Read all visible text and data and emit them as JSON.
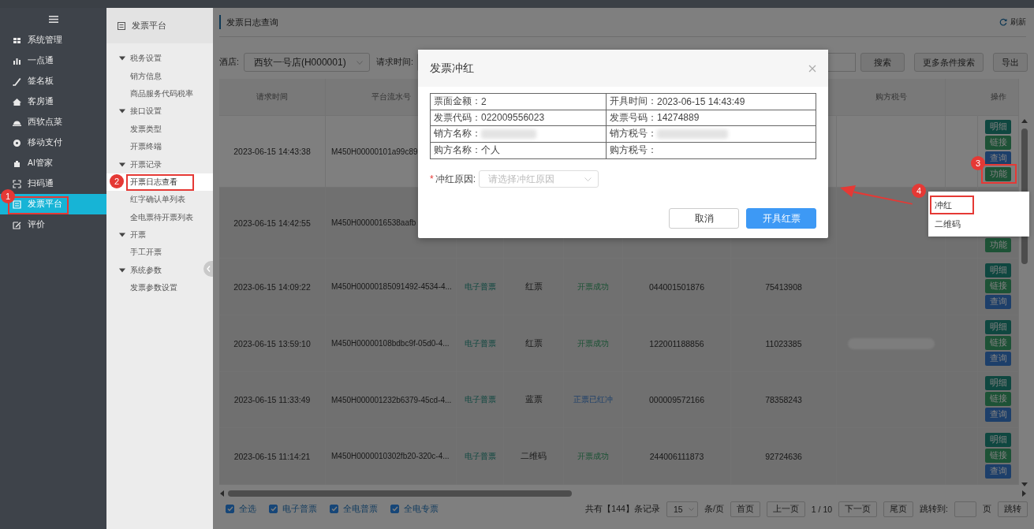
{
  "sidebar": {
    "items": [
      {
        "label": "系统管理",
        "selected": false
      },
      {
        "label": "一点通",
        "selected": false
      },
      {
        "label": "签名板",
        "selected": false
      },
      {
        "label": "客房通",
        "selected": false
      },
      {
        "label": "西软点菜",
        "selected": false
      },
      {
        "label": "移动支付",
        "selected": false
      },
      {
        "label": "AI管家",
        "selected": false
      },
      {
        "label": "扫码通",
        "selected": false
      },
      {
        "label": "发票平台",
        "selected": true,
        "annotation": "1"
      },
      {
        "label": "评价",
        "selected": false
      }
    ]
  },
  "subnav": {
    "title": "发票平台",
    "groups": [
      {
        "label": "税务设置",
        "expanded": true,
        "children": [
          {
            "label": "销方信息",
            "selected": false
          },
          {
            "label": "商品服务代码税率",
            "selected": false
          }
        ]
      },
      {
        "label": "接口设置",
        "expanded": true,
        "children": [
          {
            "label": "发票类型",
            "selected": false
          },
          {
            "label": "开票终端",
            "selected": false
          }
        ]
      },
      {
        "label": "开票记录",
        "expanded": true,
        "children": [
          {
            "label": "开票日志查看",
            "selected": true,
            "annotation": "2"
          },
          {
            "label": "红字确认单列表",
            "selected": false
          },
          {
            "label": "全电票待开票列表",
            "selected": false
          }
        ]
      },
      {
        "label": "开票",
        "expanded": true,
        "children": [
          {
            "label": "手工开票",
            "selected": false
          }
        ]
      },
      {
        "label": "系统参数",
        "expanded": true,
        "children": [
          {
            "label": "发票参数设置",
            "selected": false
          }
        ]
      }
    ]
  },
  "page": {
    "title": "发票日志查询",
    "refresh": "刷新"
  },
  "filters": {
    "hotel_label": "酒店:",
    "hotel_value": "西软一号店(H000001)",
    "time_label": "请求时间:",
    "buttons": [
      "搜索",
      "更多条件搜索",
      "导出"
    ]
  },
  "table": {
    "columns": [
      {
        "label": "请求时间"
      },
      {
        "label": "平台流水号"
      },
      {},
      {},
      {},
      {},
      {},
      {
        "label": "购方税号"
      },
      {},
      {
        "label": "操作"
      }
    ],
    "rows": [
      {
        "selected": true,
        "time": "2023-06-15 14:43:38",
        "serial": "M450H00000101a99c89",
        "actions": [
          {
            "label": "明细",
            "kind": "detail"
          },
          {
            "label": "链接",
            "kind": "link"
          },
          {
            "label": "查询",
            "kind": "query"
          },
          {
            "label": "功能",
            "kind": "function",
            "annotation": "3"
          }
        ]
      },
      {
        "selected": false,
        "time": "2023-06-15 14:42:55",
        "serial": "M450H0000016538aafb",
        "actions": [
          {
            "label": "功能",
            "kind": "function"
          }
        ]
      },
      {
        "selected": false,
        "time": "2023-06-15 14:09:22",
        "serial": "M450H00000185091492-4534-4...",
        "invoice_type": "电子普票",
        "ticket": "红票",
        "status": {
          "label": "开票成功",
          "kind": "success"
        },
        "code": "044001501876",
        "number": "75413908",
        "actions": [
          {
            "label": "明细",
            "kind": "detail"
          },
          {
            "label": "链接",
            "kind": "link"
          },
          {
            "label": "查询",
            "kind": "query"
          }
        ]
      },
      {
        "selected": false,
        "time": "2023-06-15 13:59:10",
        "serial": "M450H00000108bdbc9f-05d0-4...",
        "invoice_type": "电子普票",
        "ticket": "红票",
        "status": {
          "label": "开票成功",
          "kind": "success"
        },
        "code": "122001188856",
        "number": "11023385",
        "buyer_tax_redacted": true,
        "actions": [
          {
            "label": "明细",
            "kind": "detail"
          },
          {
            "label": "链接",
            "kind": "link"
          },
          {
            "label": "查询",
            "kind": "query"
          }
        ]
      },
      {
        "selected": false,
        "time": "2023-06-15 11:33:49",
        "serial": "M450H000001232b6379-45cd-4...",
        "invoice_type": "电子普票",
        "ticket": "蓝票",
        "status": {
          "label": "正票已红冲",
          "kind": "reversed"
        },
        "code": "000009572166",
        "number": "78358243",
        "actions": [
          {
            "label": "明细",
            "kind": "detail"
          },
          {
            "label": "链接",
            "kind": "link"
          },
          {
            "label": "查询",
            "kind": "query"
          }
        ]
      },
      {
        "selected": false,
        "time": "2023-06-15 11:14:21",
        "serial": "M450H0000010302fb20-320c-4...",
        "invoice_type": "电子普票",
        "ticket": "二维码",
        "status": {
          "label": "开票成功",
          "kind": "success"
        },
        "code": "244006111873",
        "number": "92724636",
        "actions": [
          {
            "label": "明细",
            "kind": "detail"
          },
          {
            "label": "链接",
            "kind": "link"
          },
          {
            "label": "查询",
            "kind": "query"
          }
        ]
      }
    ]
  },
  "footer": {
    "checkboxes": [
      {
        "label": "全选",
        "checked": true
      },
      {
        "label": "电子普票",
        "checked": true
      },
      {
        "label": "全电普票",
        "checked": true
      },
      {
        "label": "全电专票",
        "checked": true
      }
    ],
    "total": "共有【144】条记录",
    "page_size": "15",
    "page_size_unit": "条/页",
    "first": "首页",
    "prev": "上一页",
    "page_info": "1 / 10",
    "next": "下一页",
    "last": "尾页",
    "jump_label": "跳转到:",
    "jump_unit": "页",
    "jump_button": "跳转"
  },
  "dialog": {
    "title": "发票冲红",
    "info": [
      {
        "label": "票面金额：",
        "value": "2"
      },
      {
        "label": "开具时间：",
        "value": "2023-06-15 14:43:49"
      },
      {
        "label": "发票代码：",
        "value": "022009556023"
      },
      {
        "label": "发票号码：",
        "value": "14274889"
      },
      {
        "label": "销方名称：",
        "redacted": true
      },
      {
        "label": "销方税号：",
        "redacted": true
      },
      {
        "label": "购方名称：",
        "value": "个人"
      },
      {
        "label": "购方税号："
      }
    ],
    "reason": {
      "required_mark": "*",
      "label": "冲红原因:",
      "placeholder": "请选择冲红原因"
    },
    "buttons": [
      {
        "label": "取消",
        "kind": "secondary"
      },
      {
        "label": "开具红票",
        "kind": "primary"
      }
    ]
  },
  "menu": {
    "items": [
      {
        "label": "冲红",
        "annotation": "4"
      },
      {
        "label": "二维码"
      }
    ]
  },
  "callout_arrow": true
}
